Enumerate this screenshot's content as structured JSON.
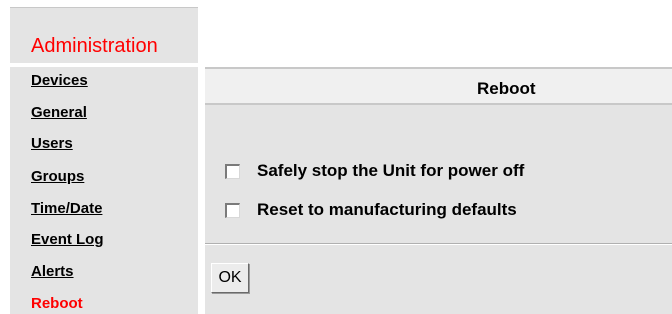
{
  "sidebar": {
    "title": "Administration",
    "items": [
      {
        "label": "Devices"
      },
      {
        "label": "General"
      },
      {
        "label": "Users"
      },
      {
        "label": "Groups"
      },
      {
        "label": "Time/Date"
      },
      {
        "label": "Event Log"
      },
      {
        "label": "Alerts"
      },
      {
        "label": "Reboot",
        "active": true
      }
    ]
  },
  "panel": {
    "title": "Reboot",
    "options": [
      {
        "label": "Safely stop the Unit for power off",
        "checked": false
      },
      {
        "label": "Reset to manufacturing defaults",
        "checked": false
      }
    ],
    "ok_label": "OK"
  },
  "colors": {
    "active_link": "#ff0000",
    "panel_background": "#e4e4e4",
    "header_background": "#f0f0f0"
  }
}
